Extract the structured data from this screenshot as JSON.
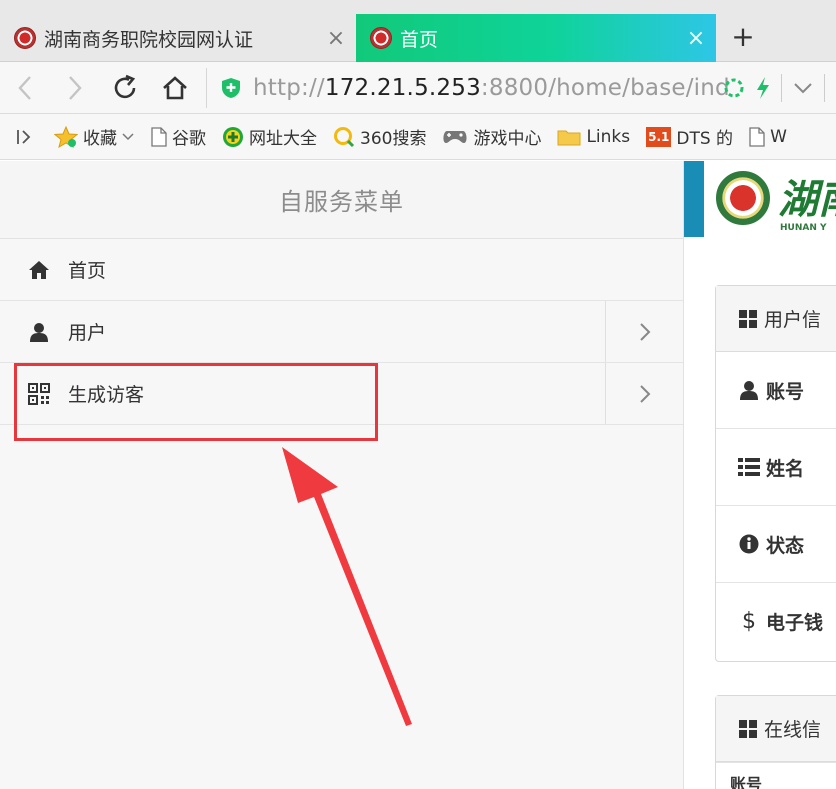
{
  "tabs": [
    {
      "title": "湖南商务职院校园网认证",
      "active": false
    },
    {
      "title": "首页",
      "active": true
    }
  ],
  "tab_close_glyph": "×",
  "new_tab_glyph": "+",
  "address": {
    "scheme": "http://",
    "host": "172.21.5.253",
    "rest": ":8800/home/base/ind"
  },
  "bookmarks": [
    {
      "icon": "star-icon",
      "label": "收藏",
      "dropdown": true
    },
    {
      "icon": "page-icon",
      "label": "谷歌"
    },
    {
      "icon": "plus-circle-icon",
      "label": "网址大全"
    },
    {
      "icon": "search-circle-icon",
      "label": "360搜索"
    },
    {
      "icon": "gamepad-icon",
      "label": "游戏中心"
    },
    {
      "icon": "folder-icon",
      "label": "Links"
    },
    {
      "icon": "dts-icon",
      "label": "DTS 的",
      "badge": "5.1"
    },
    {
      "icon": "page-icon",
      "label": "W"
    }
  ],
  "sidebar": {
    "title": "自服务菜单",
    "items": [
      {
        "icon": "home-icon",
        "label": "首页",
        "has_arrow": false
      },
      {
        "icon": "user-icon",
        "label": "用户",
        "has_arrow": true
      },
      {
        "icon": "qrcode-icon",
        "label": "生成访客",
        "has_arrow": true
      }
    ]
  },
  "main": {
    "logo_text": "湖南",
    "logo_sub": "HUNAN Y",
    "panel_user": {
      "title": "用户信",
      "rows": [
        {
          "icon": "user-icon",
          "label": "账号"
        },
        {
          "icon": "list-icon",
          "label": "姓名"
        },
        {
          "icon": "info-icon",
          "label": "状态"
        },
        {
          "icon": "dollar-icon",
          "label": "电子钱"
        }
      ]
    },
    "panel_online": {
      "title": "在线信",
      "cut_row": "账号"
    }
  },
  "colors": {
    "active_tab_start": "#11c97a",
    "active_tab_end": "#2ec6e6",
    "highlight": "#e8373c",
    "teal_strip": "#1a8db6"
  }
}
